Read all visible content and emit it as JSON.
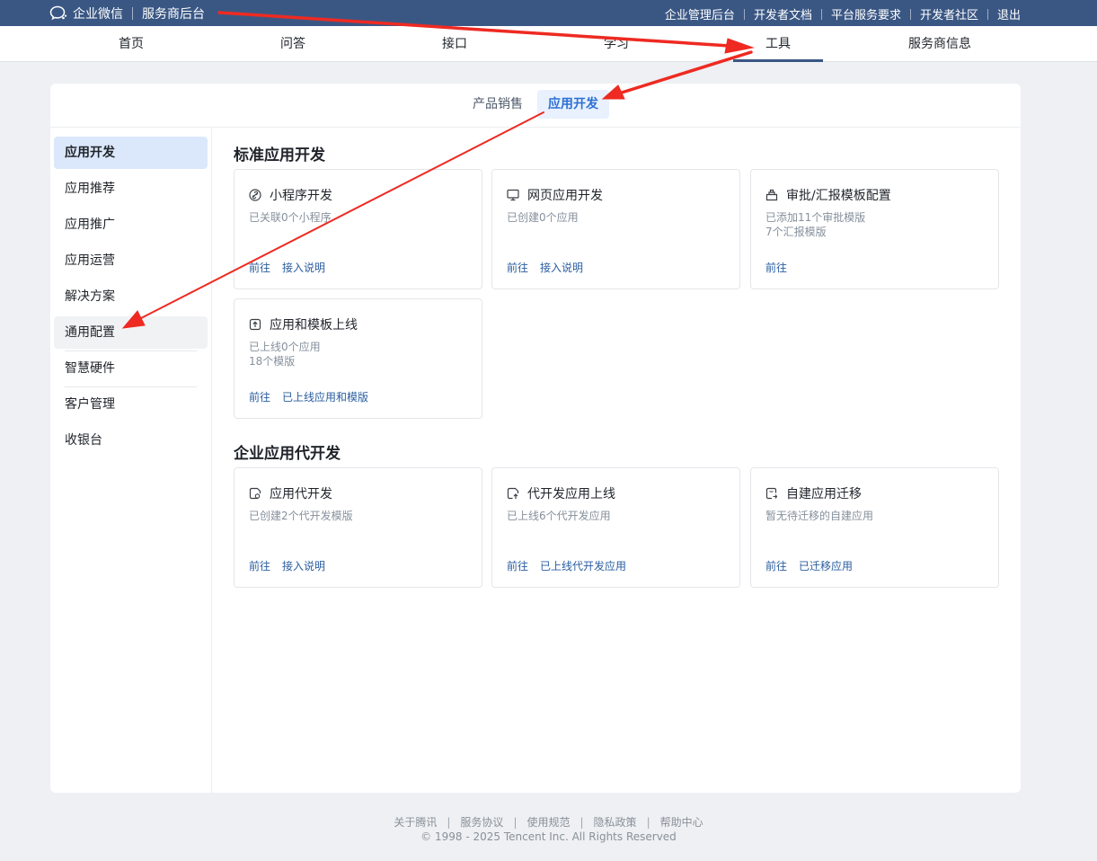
{
  "topbar": {
    "brand": "企业微信",
    "subtitle": "服务商后台",
    "links": [
      "企业管理后台",
      "开发者文档",
      "平台服务要求",
      "开发者社区",
      "退出"
    ]
  },
  "nav": {
    "items": [
      "首页",
      "问答",
      "接口",
      "学习",
      "工具",
      "服务商信息"
    ],
    "active": "工具"
  },
  "subtabs": {
    "items": [
      "产品销售",
      "应用开发"
    ],
    "active": "应用开发"
  },
  "sidebar": {
    "items": [
      "应用开发",
      "应用推荐",
      "应用推广",
      "应用运营",
      "解决方案",
      "通用配置",
      "智慧硬件",
      "客户管理",
      "收银台"
    ],
    "active": "应用开发"
  },
  "standard": {
    "title": "标准应用开发",
    "tiles": [
      {
        "icon": "link-icon",
        "title": "小程序开发",
        "desc1": "已关联0个小程序",
        "desc2": "",
        "action1": "前往",
        "action2": "接入说明"
      },
      {
        "icon": "monitor-icon",
        "title": "网页应用开发",
        "desc1": "已创建0个应用",
        "desc2": "",
        "action1": "前往",
        "action2": "接入说明"
      },
      {
        "icon": "template-icon",
        "title": "审批/汇报模板配置",
        "desc1": "已添加11个审批模版",
        "desc2": "7个汇报模版",
        "action1": "前往",
        "action2": ""
      },
      {
        "icon": "upload-icon",
        "title": "应用和模板上线",
        "desc1": "已上线0个应用",
        "desc2": "18个模版",
        "action1": "前往",
        "action2": "已上线应用和模版"
      }
    ]
  },
  "agency": {
    "title": "企业应用代开发",
    "tiles": [
      {
        "icon": "agency-dev-icon",
        "title": "应用代开发",
        "desc1": "已创建2个代开发模版",
        "desc2": "",
        "action1": "前往",
        "action2": "接入说明"
      },
      {
        "icon": "agency-launch-icon",
        "title": "代开发应用上线",
        "desc1": "已上线6个代开发应用",
        "desc2": "",
        "action1": "前往",
        "action2": "已上线代开发应用"
      },
      {
        "icon": "migrate-icon",
        "title": "自建应用迁移",
        "desc1": "暂无待迁移的自建应用",
        "desc2": "",
        "action1": "前往",
        "action2": "已迁移应用"
      }
    ]
  },
  "footer": {
    "links": [
      "关于腾讯",
      "服务协议",
      "使用规范",
      "隐私政策",
      "帮助中心"
    ],
    "copyright": "© 1998 - 2025 Tencent Inc. All Rights Reserved"
  },
  "colors": {
    "topbar": "#3a5784",
    "link": "#2a5d9f",
    "active_tab_bg": "#e8f1fd",
    "annotation_arrow": "#ee2a22"
  }
}
